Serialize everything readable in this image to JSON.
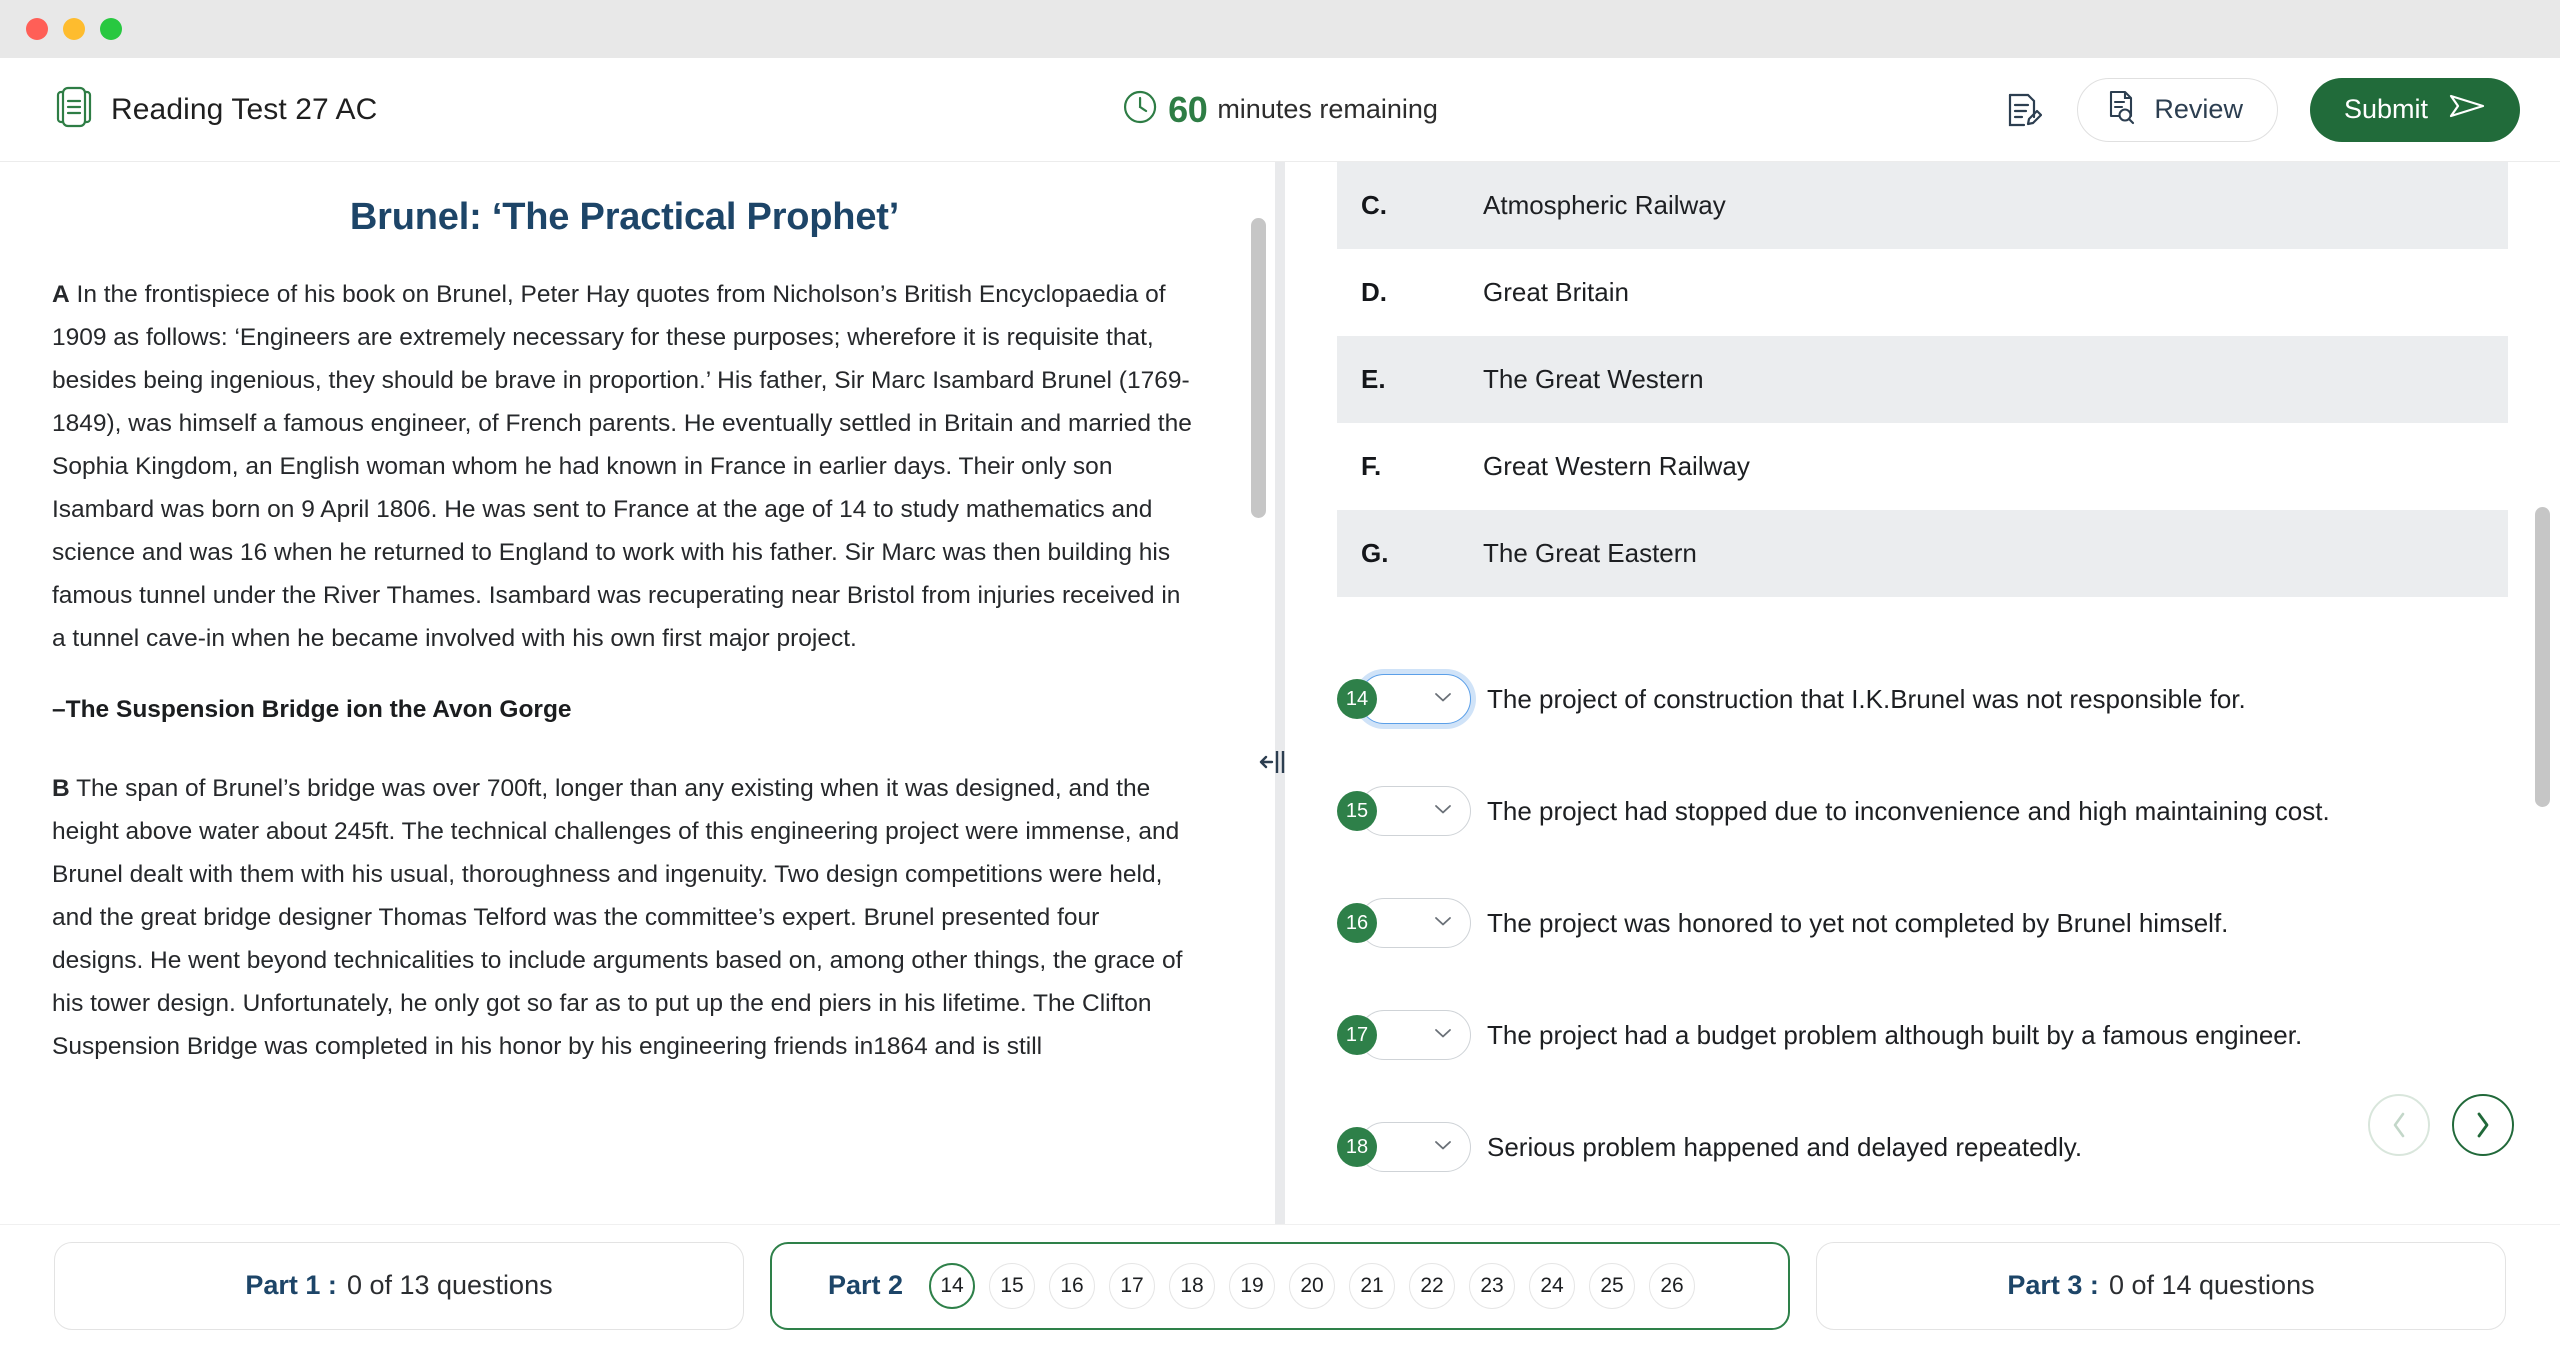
{
  "window": {
    "traffic_lights": [
      "close",
      "minimize",
      "maximize"
    ]
  },
  "header": {
    "logo_icon": "book-icon",
    "title": "Reading Test 27 AC",
    "timer": {
      "icon": "clock-icon",
      "minutes": "60",
      "label": "minutes remaining"
    },
    "notes_icon": "note-edit-icon",
    "review": {
      "icon": "document-search-icon",
      "label": "Review"
    },
    "submit": {
      "label": "Submit",
      "icon": "send-icon"
    }
  },
  "passage": {
    "title": "Brunel: ‘The Practical Prophet’",
    "paragraphs": [
      {
        "label": "A",
        "text": " In the frontispiece of his book on Brunel, Peter Hay quotes from Nicholson’s British Encyclopaedia of 1909 as follows: ‘Engineers are extremely necessary for these purposes; wherefore it is requisite that, besides being ingenious, they should be brave in proportion.’ His father, Sir Marc Isambard Brunel (1769-1849), was himself a famous engineer, of French parents. He eventually settled in Britain and married the Sophia Kingdom, an English woman whom he had known in France in earlier days. Their only son Isambard was born on 9 April 1806. He was sent to France at the age of 14 to study mathematics and science and was 16 when he returned to England to work with his father. Sir Marc was then building his famous tunnel under the River Thames. Isambard was recuperating near Bristol from injuries received in a tunnel cave-in when he became involved with his own first major project."
      }
    ],
    "subheading": "–The Suspension Bridge ion the Avon Gorge",
    "paragraph_b": {
      "label": "B",
      "text": " The span of Brunel’s bridge was over 700ft, longer than any existing when it was designed, and the height above water about 245ft. The technical challenges of this engineering project were immense, and Brunel dealt with them with his usual, thoroughness and ingenuity. Two design competitions were held, and the great bridge designer Thomas Telford was the committee’s expert. Brunel presented four designs. He went beyond technicalities to include arguments based on, among other things, the grace of his tower design. Unfortunately, he only got so far as to put up the end piers in his lifetime. The Clifton Suspension Bridge was completed in his honor by his engineering friends in1864 and is still"
    }
  },
  "splitter": {
    "icon": "resize-horizontal-icon"
  },
  "questions_panel": {
    "options": [
      {
        "letter": "C.",
        "text": "Atmospheric Railway",
        "shaded": true
      },
      {
        "letter": "D.",
        "text": "Great Britain",
        "shaded": false
      },
      {
        "letter": "E.",
        "text": "The Great Western",
        "shaded": true
      },
      {
        "letter": "F.",
        "text": "Great Western Railway",
        "shaded": false
      },
      {
        "letter": "G.",
        "text": "The Great Eastern",
        "shaded": true
      }
    ],
    "questions": [
      {
        "number": "14",
        "value": "",
        "focused": true,
        "text": "The project of construction that I.K.Brunel was not responsible for."
      },
      {
        "number": "15",
        "value": "",
        "focused": false,
        "text": "The project had stopped due to inconvenience and high maintaining cost."
      },
      {
        "number": "16",
        "value": "",
        "focused": false,
        "text": "The project was honored to yet not completed by Brunel himself."
      },
      {
        "number": "17",
        "value": "",
        "focused": false,
        "text": "The project had a budget problem although built by a famous engineer."
      },
      {
        "number": "18",
        "value": "",
        "focused": false,
        "text": "Serious problem happened and delayed repeatedly."
      }
    ],
    "nav": {
      "prev_icon": "chevron-left-icon",
      "next_icon": "chevron-right-icon"
    }
  },
  "bottom_bar": {
    "part1": {
      "label": "Part 1 :",
      "count": "0 of 13 questions"
    },
    "part2": {
      "label": "Part 2",
      "numbers": [
        "14",
        "15",
        "16",
        "17",
        "18",
        "19",
        "20",
        "21",
        "22",
        "23",
        "24",
        "25",
        "26"
      ],
      "selected": "14"
    },
    "part3": {
      "label": "Part 3 :",
      "count": "0 of 14 questions"
    }
  },
  "colors": {
    "brand_green": "#2e8049",
    "submit_green": "#216b3a",
    "navy": "#1d4568",
    "focus_blue": "#5b9fe8",
    "shade_grey": "#ebedef"
  }
}
